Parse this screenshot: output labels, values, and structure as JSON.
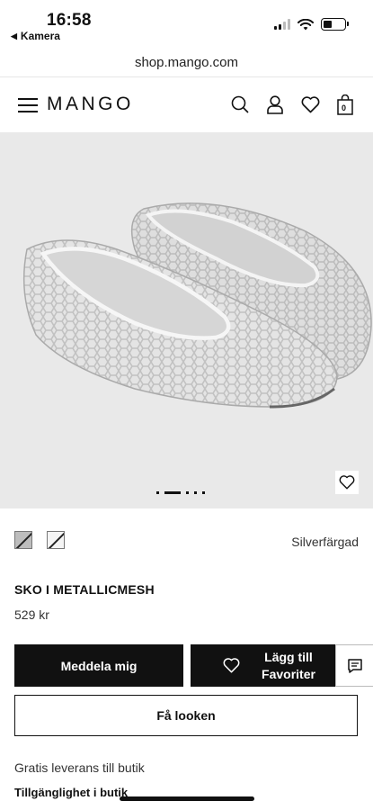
{
  "status_bar": {
    "time": "16:58",
    "back_label": "Kamera"
  },
  "browser": {
    "url": "shop.mango.com"
  },
  "header": {
    "logo": "MANGO",
    "bag_count": "0"
  },
  "product": {
    "color_name": "Silverfärgad",
    "name": "SKO I METALLICMESH",
    "price": "529 kr",
    "image_page": {
      "current": 2,
      "total": 5
    }
  },
  "actions": {
    "notify_label": "Meddela mig",
    "favorites_label": "Lägg till Favoriter",
    "look_label": "Få looken"
  },
  "info": {
    "delivery": "Gratis leverans till butik",
    "availability": "Tillgänglighet i butik"
  },
  "icons": {
    "menu": "hamburger-icon",
    "search": "search-icon",
    "account": "user-icon",
    "wishlist": "heart-icon",
    "bag": "shopping-bag-icon",
    "chat": "chat-icon"
  }
}
